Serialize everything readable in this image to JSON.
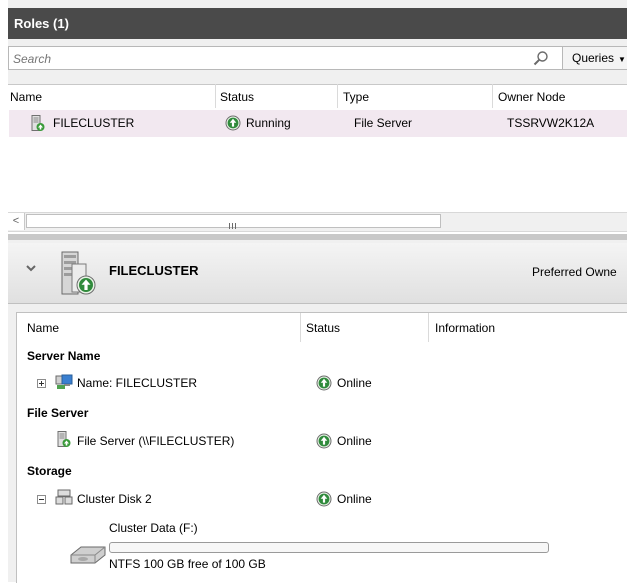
{
  "roles": {
    "header": "Roles (1)",
    "search_placeholder": "Search",
    "queries_label": "Queries",
    "columns": [
      "Name",
      "Status",
      "Type",
      "Owner Node"
    ],
    "rows": [
      {
        "name": "FILECLUSTER",
        "status": "Running",
        "type": "File Server",
        "owner": "TSSRVW2K12A"
      }
    ],
    "scroll_grip": "III"
  },
  "detail": {
    "title": "FILECLUSTER",
    "preferred_owners_label": "Preferred Owne",
    "columns": [
      "Name",
      "Status",
      "Information"
    ],
    "groups": [
      {
        "label": "Server Name",
        "items": [
          {
            "name": "Name: FILECLUSTER",
            "status": "Online"
          }
        ]
      },
      {
        "label": "File Server",
        "items": [
          {
            "name": "File Server (\\\\FILECLUSTER)",
            "status": "Online"
          }
        ]
      },
      {
        "label": "Storage",
        "items": [
          {
            "name": "Cluster Disk 2",
            "status": "Online"
          }
        ]
      }
    ],
    "volume": {
      "label": "Cluster Data (F:)",
      "free_text": "NTFS 100 GB free of 100 GB",
      "used_fraction": 0.0
    }
  },
  "colors": {
    "header_bg": "#4a4a4a",
    "selected_row": "#f2e8f0",
    "status_green": "#2f8a3b"
  },
  "icons": [
    "search-icon",
    "chevron-down-icon",
    "server-role-icon",
    "status-up-icon",
    "network-name-icon",
    "file-server-icon",
    "cluster-disk-icon",
    "hard-disk-icon"
  ]
}
